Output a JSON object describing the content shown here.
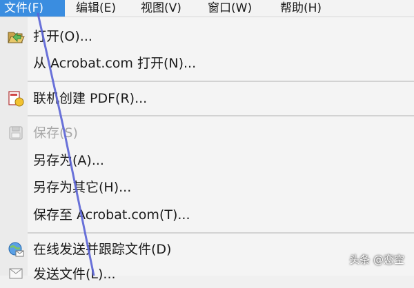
{
  "menubar": {
    "items": [
      {
        "label": "文件(F)"
      },
      {
        "label": "编辑(E)"
      },
      {
        "label": "视图(V)"
      },
      {
        "label": "窗口(W)"
      },
      {
        "label": "帮助(H)"
      }
    ]
  },
  "file_menu": {
    "open": "打开(O)...",
    "open_acrobat": "从 Acrobat.com 打开(N)...",
    "create_pdf_online": "联机创建 PDF(R)...",
    "save": "保存(S)",
    "save_as": "另存为(A)...",
    "save_as_other": "另存为其它(H)...",
    "save_to_acrobat": "保存至 Acrobat.com(T)...",
    "send_track": "在线发送并跟踪文件(D)",
    "send_file": "发送文件(L)..."
  },
  "watermark": "头条 @恋空",
  "colors": {
    "highlight": "#3a8de0",
    "annotation_line": "#5a63d6"
  }
}
